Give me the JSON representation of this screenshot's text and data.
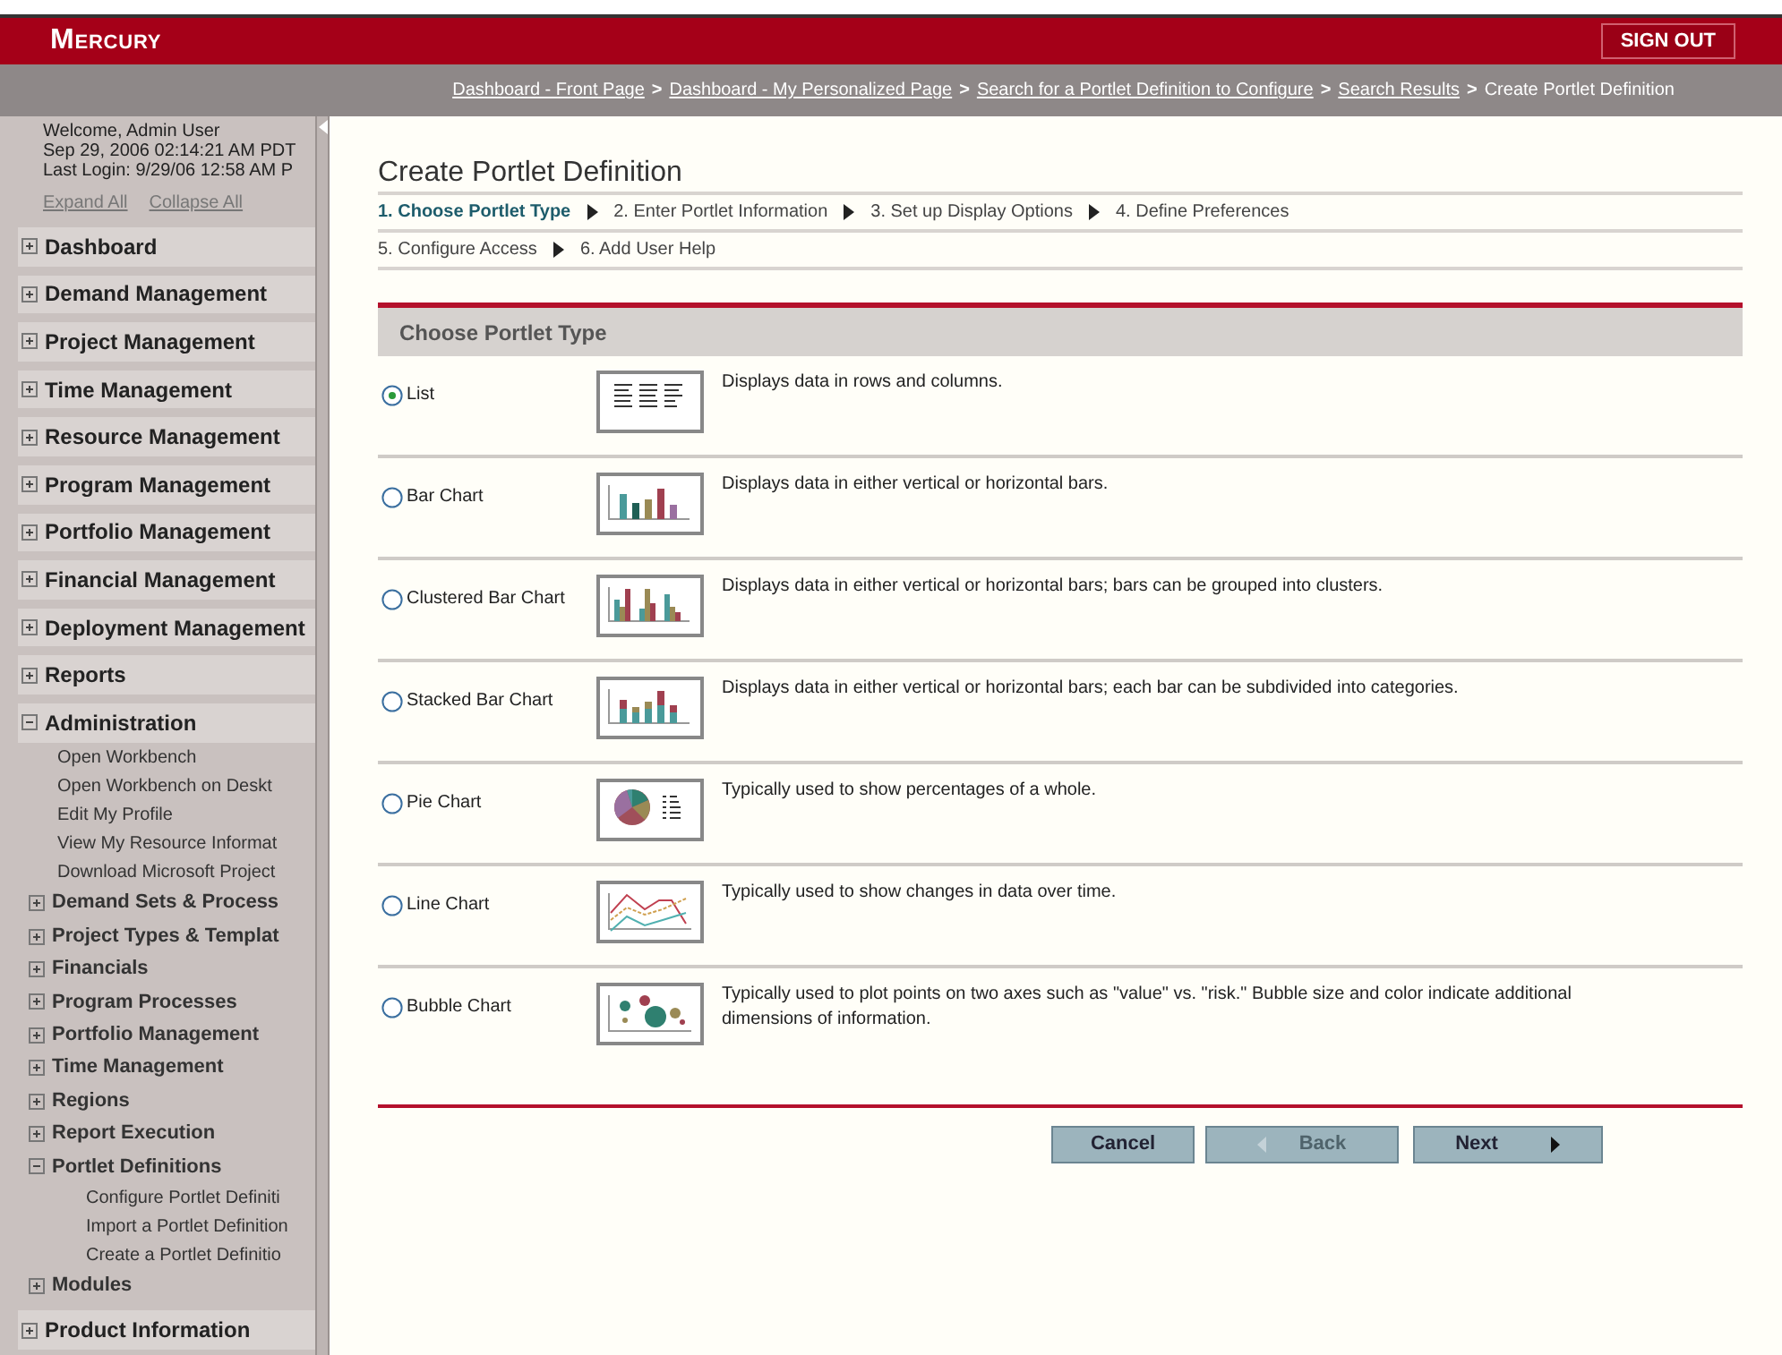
{
  "header": {
    "logo": "Mercury",
    "sign_out": "SIGN OUT"
  },
  "breadcrumb": {
    "separator": ">",
    "items": [
      {
        "label": "Dashboard - Front Page",
        "link": true
      },
      {
        "label": "Dashboard - My Personalized Page",
        "link": true
      },
      {
        "label": "Search for a Portlet Definition to Configure",
        "link": true
      },
      {
        "label": "Search Results",
        "link": true
      },
      {
        "label": "Create Portlet Definition",
        "link": false
      }
    ]
  },
  "sidebar": {
    "welcome": [
      "Welcome, Admin User",
      "Sep 29, 2006 02:14:21 AM PDT",
      "Last Login: 9/29/06 12:58 AM P"
    ],
    "expand_all": "Expand All",
    "collapse_all": "Collapse All",
    "items": [
      {
        "label": "Dashboard",
        "expanded": false
      },
      {
        "label": "Demand Management",
        "expanded": false
      },
      {
        "label": "Project Management",
        "expanded": false
      },
      {
        "label": "Time Management",
        "expanded": false
      },
      {
        "label": "Resource Management",
        "expanded": false
      },
      {
        "label": "Program Management",
        "expanded": false
      },
      {
        "label": "Portfolio Management",
        "expanded": false
      },
      {
        "label": "Financial Management",
        "expanded": false
      },
      {
        "label": "Deployment Management",
        "expanded": false
      },
      {
        "label": "Reports",
        "expanded": false
      },
      {
        "label": "Administration",
        "expanded": true,
        "children": [
          {
            "kind": "link",
            "label": "Open Workbench"
          },
          {
            "kind": "link",
            "label": "Open Workbench on Deskt"
          },
          {
            "kind": "link",
            "label": "Edit My Profile"
          },
          {
            "kind": "link",
            "label": "View My Resource Informat"
          },
          {
            "kind": "link",
            "label": "Download Microsoft Project"
          },
          {
            "kind": "group",
            "label": "Demand Sets & Process",
            "expanded": false
          },
          {
            "kind": "group",
            "label": "Project Types & Templat",
            "expanded": false
          },
          {
            "kind": "group",
            "label": "Financials",
            "expanded": false
          },
          {
            "kind": "group",
            "label": "Program Processes",
            "expanded": false
          },
          {
            "kind": "group",
            "label": "Portfolio Management",
            "expanded": false
          },
          {
            "kind": "group",
            "label": "Time Management",
            "expanded": false
          },
          {
            "kind": "group",
            "label": "Regions",
            "expanded": false
          },
          {
            "kind": "group",
            "label": "Report Execution",
            "expanded": false
          },
          {
            "kind": "group",
            "label": "Portlet Definitions",
            "expanded": true,
            "children": [
              {
                "kind": "link",
                "label": "Configure Portlet Definiti"
              },
              {
                "kind": "link",
                "label": "Import a Portlet Definition"
              },
              {
                "kind": "link",
                "label": "Create a Portlet Definitio"
              }
            ]
          },
          {
            "kind": "group",
            "label": "Modules",
            "expanded": false
          }
        ]
      },
      {
        "label": "Product Information",
        "expanded": false
      }
    ]
  },
  "page": {
    "title": "Create Portlet Definition",
    "step_rows": [
      [
        {
          "label": "1. Choose Portlet Type",
          "selected": true
        },
        {
          "label": "2. Enter Portlet Information",
          "selected": false
        },
        {
          "label": "3. Set up Display Options",
          "selected": false
        },
        {
          "label": "4. Define Preferences",
          "selected": false
        }
      ],
      [
        {
          "label": "5. Configure Access",
          "selected": false
        },
        {
          "label": "6. Add User Help",
          "selected": false
        }
      ]
    ],
    "section_title": "Choose Portlet Type",
    "portlet_types": [
      {
        "kind": "list",
        "label": "List",
        "selected": true,
        "description": "Displays data in rows and columns."
      },
      {
        "kind": "bar",
        "label": "Bar Chart",
        "selected": false,
        "description": "Displays data in either vertical or horizontal bars."
      },
      {
        "kind": "clustered",
        "label": "Clustered Bar Chart",
        "selected": false,
        "description": "Displays data in either vertical or horizontal bars; bars can be grouped into clusters."
      },
      {
        "kind": "stacked",
        "label": "Stacked Bar Chart",
        "selected": false,
        "description": "Displays data in either vertical or horizontal bars; each bar can be subdivided into categories."
      },
      {
        "kind": "pie",
        "label": "Pie Chart",
        "selected": false,
        "description": "Typically used to show percentages of a whole."
      },
      {
        "kind": "line",
        "label": "Line Chart",
        "selected": false,
        "description": "Typically used to show changes in data over time."
      },
      {
        "kind": "bubble",
        "label": "Bubble Chart",
        "selected": false,
        "description": "Typically used to plot points on two axes such as \"value\" vs. \"risk.\" Bubble size and color indicate additional dimensions of information."
      }
    ],
    "buttons": [
      {
        "kind": "cancel",
        "label": "Cancel",
        "disabled": false
      },
      {
        "kind": "back",
        "label": "Back",
        "disabled": true
      },
      {
        "kind": "next",
        "label": "Next",
        "disabled": false
      }
    ]
  }
}
